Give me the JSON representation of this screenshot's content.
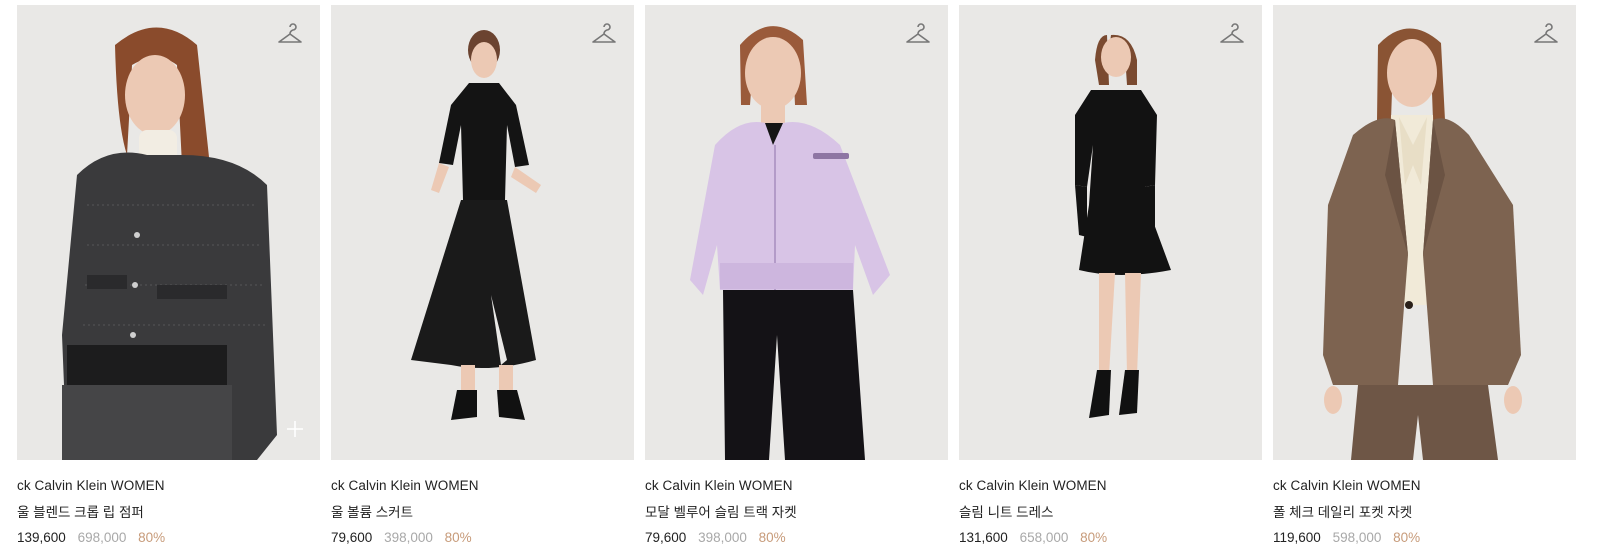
{
  "colors": {
    "thumb_bg": "#e9e8e6",
    "discount": "#c79b7a",
    "original_price": "#a8a8a8",
    "text": "#222222"
  },
  "products": [
    {
      "brand": "ck Calvin Klein WOMEN",
      "name": "울 블렌드 크롭 립 점퍼",
      "sale_price": "139,600",
      "original_price": "698,000",
      "discount": "80%",
      "wishlist_icon": "hanger-icon",
      "quick_add_icon": "plus-icon",
      "garment_color": "#3a3a3c",
      "inner_color": "#f2ede3",
      "hair_color": "#8a4b2c"
    },
    {
      "brand": "ck Calvin Klein WOMEN",
      "name": "울 볼륨 스커트",
      "sale_price": "79,600",
      "original_price": "398,000",
      "discount": "80%",
      "wishlist_icon": "hanger-icon",
      "garment_color": "#141414",
      "inner_color": "#141414",
      "hair_color": "#6b4330"
    },
    {
      "brand": "ck Calvin Klein WOMEN",
      "name": "모달 벨루어 슬림 트랙 자켓",
      "sale_price": "79,600",
      "original_price": "398,000",
      "discount": "80%",
      "wishlist_icon": "hanger-icon",
      "garment_color": "#d8c4e6",
      "inner_color": "#151515",
      "hair_color": "#9a5a3a"
    },
    {
      "brand": "ck Calvin Klein WOMEN",
      "name": "슬림 니트 드레스",
      "sale_price": "131,600",
      "original_price": "658,000",
      "discount": "80%",
      "wishlist_icon": "hanger-icon",
      "garment_color": "#121212",
      "inner_color": "#121212",
      "hair_color": "#7a4a30"
    },
    {
      "brand": "ck Calvin Klein WOMEN",
      "name": "폴 체크 데일리 포켓 자켓",
      "sale_price": "119,600",
      "original_price": "598,000",
      "discount": "80%",
      "wishlist_icon": "hanger-icon",
      "garment_color": "#7d6350",
      "inner_color": "#f1ead8",
      "hair_color": "#8a5434"
    }
  ]
}
